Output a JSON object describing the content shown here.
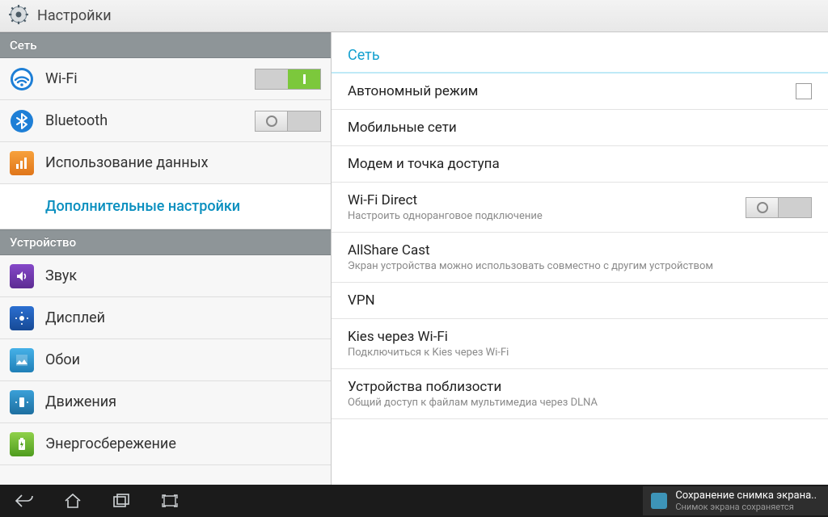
{
  "header": {
    "title": "Настройки"
  },
  "sidebar": {
    "sections": [
      {
        "title": "Сеть",
        "items": [
          {
            "id": "wifi",
            "label": "Wi-Fi",
            "icon": "wifi-icon",
            "toggle": "on"
          },
          {
            "id": "bluetooth",
            "label": "Bluetooth",
            "icon": "bluetooth-icon",
            "toggle": "off"
          },
          {
            "id": "datausage",
            "label": "Использование данных",
            "icon": "datausage-icon"
          },
          {
            "id": "more",
            "label": "Дополнительные настройки",
            "selected": true,
            "indent": true
          }
        ]
      },
      {
        "title": "Устройство",
        "items": [
          {
            "id": "sound",
            "label": "Звук",
            "icon": "sound-icon"
          },
          {
            "id": "display",
            "label": "Дисплей",
            "icon": "display-icon"
          },
          {
            "id": "wallpaper",
            "label": "Обои",
            "icon": "wallpaper-icon"
          },
          {
            "id": "motion",
            "label": "Движения",
            "icon": "motion-icon"
          },
          {
            "id": "power",
            "label": "Энергосбережение",
            "icon": "battery-icon"
          }
        ]
      }
    ]
  },
  "content": {
    "header": "Сеть",
    "rows": [
      {
        "id": "airplane",
        "primary": "Автономный режим",
        "checkbox": false
      },
      {
        "id": "mobile",
        "primary": "Мобильные сети"
      },
      {
        "id": "tether",
        "primary": "Модем и точка доступа"
      },
      {
        "id": "wifidirect",
        "primary": "Wi-Fi Direct",
        "secondary": "Настроить одноранговое подключение",
        "toggle": "off"
      },
      {
        "id": "allshare",
        "primary": "AllShare Cast",
        "secondary": "Экран устройства можно использовать совместно с другим устройством"
      },
      {
        "id": "vpn",
        "primary": "VPN"
      },
      {
        "id": "kies",
        "primary": "Kies через Wi-Fi",
        "secondary": "Подключиться к Kies через Wi-Fi"
      },
      {
        "id": "nearby",
        "primary": "Устройства поблизости",
        "secondary": "Общий доступ к файлам мультимедиа через DLNA"
      }
    ]
  },
  "sysbar": {
    "toast": {
      "title": "Сохранение снимка экрана..",
      "subtitle": "Снимок экрана сохраняется"
    }
  },
  "colors": {
    "accent": "#13a0cf",
    "toggle_on": "#7cc83c"
  }
}
